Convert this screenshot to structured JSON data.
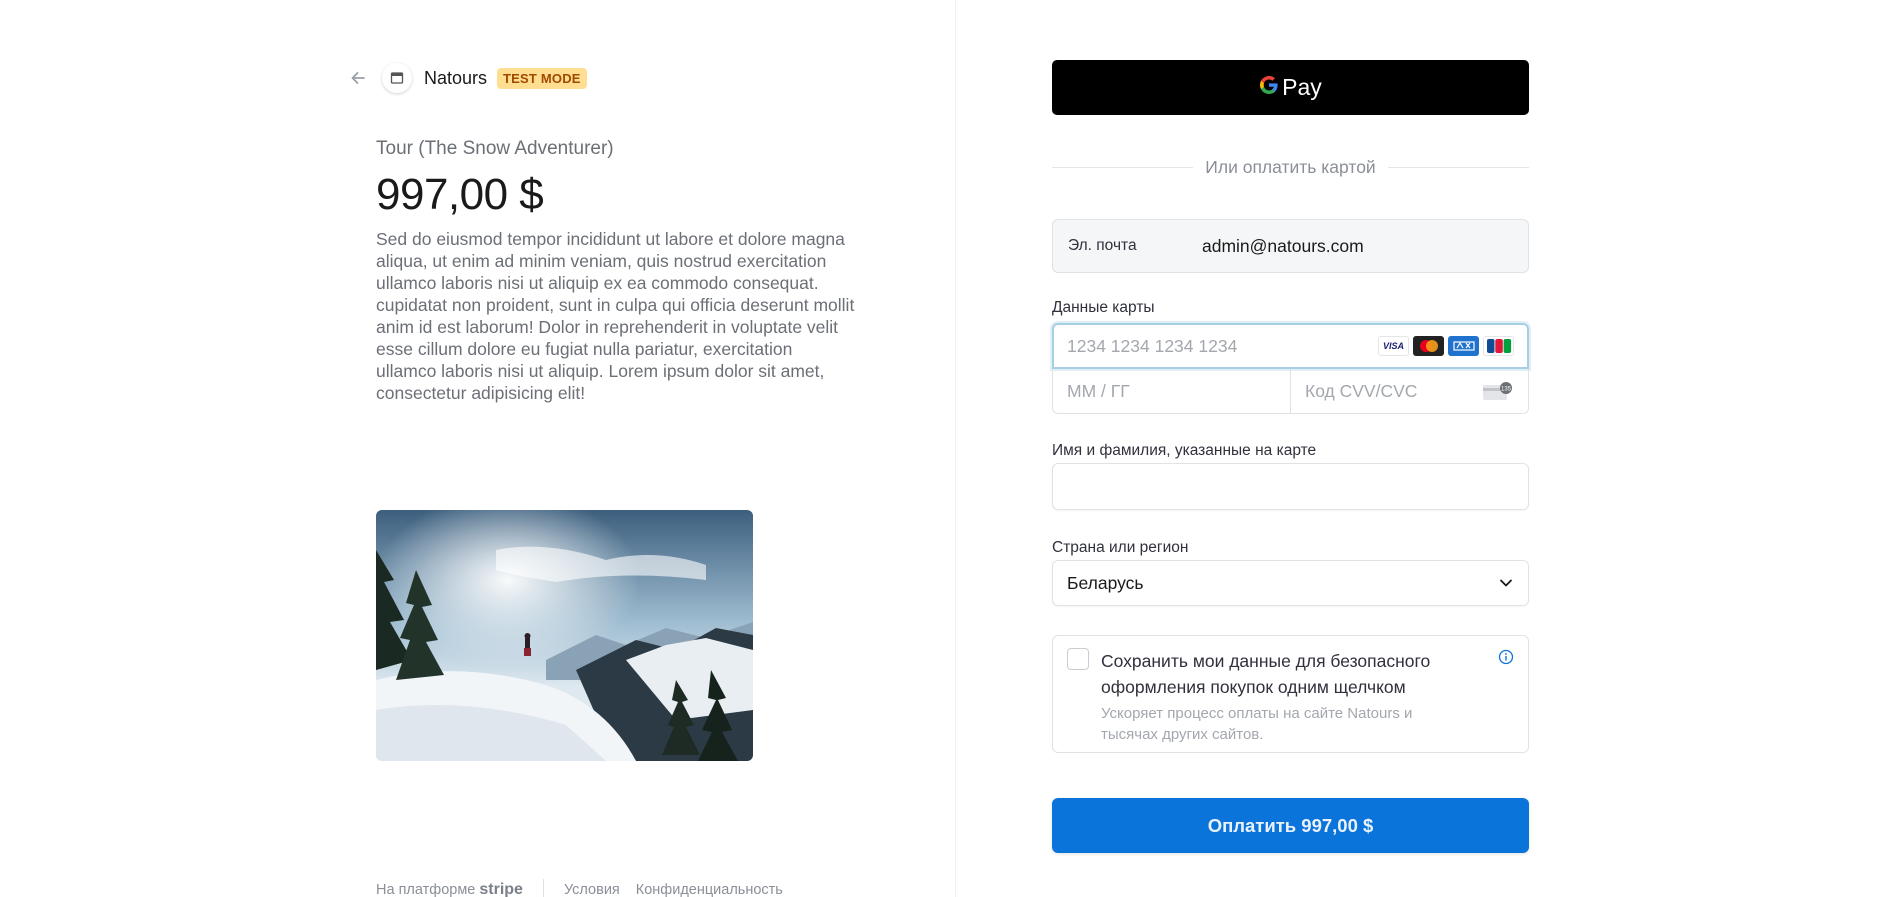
{
  "header": {
    "back_icon": "arrow-left-icon",
    "merchant_name": "Natours",
    "test_badge": "TEST MODE"
  },
  "product": {
    "name": "Tour (The Snow Adventurer)",
    "price": "997,00 $",
    "description": "Sed do eiusmod tempor incididunt ut labore et dolore magna aliqua, ut enim ad minim veniam, quis nostrud exercitation ullamco laboris nisi ut aliquip ex ea commodo consequat. cupidatat non proident, sunt in culpa qui officia deserunt mollit anim id est laborum! Dolor in reprehenderit in voluptate velit esse cillum dolore eu fugiat nulla pariatur, exercitation ullamco laboris nisi ut aliquip. Lorem ipsum dolor sit amet, consectetur adipisicing elit!",
    "image": "snowy-mountain-hiker-photo"
  },
  "footer": {
    "powered_by": "На платформе",
    "stripe": "stripe",
    "terms": "Условия",
    "privacy": "Конфиденциальность"
  },
  "payment": {
    "gpay_g": "G",
    "gpay_label": "Pay",
    "or_card": "Или оплатить картой",
    "email_label": "Эл. почта",
    "email_value": "admin@natours.com",
    "card_label": "Данные карты",
    "card_number_placeholder": "1234 1234 1234 1234",
    "brands": [
      "VISA",
      "mastercard",
      "amex",
      "JCB"
    ],
    "expiry_placeholder": "ММ / ГГ",
    "cvc_placeholder": "Код CVV/CVC",
    "cvc_badge": "135",
    "name_label": "Имя и фамилия, указанные на карте",
    "name_value": "",
    "country_label": "Страна или регион",
    "country_value": "Беларусь",
    "save_title": "Сохранить мои данные для безопасного оформления покупок одним щелчком",
    "save_sub": "Ускоряет процесс оплаты на сайте Natours и тысячах других сайтов.",
    "pay_button": "Оплатить 997,00 $"
  },
  "colors": {
    "pay_button": "#0a74da",
    "test_badge_bg": "#ffde92",
    "focus_ring": "#a6cfe6"
  }
}
